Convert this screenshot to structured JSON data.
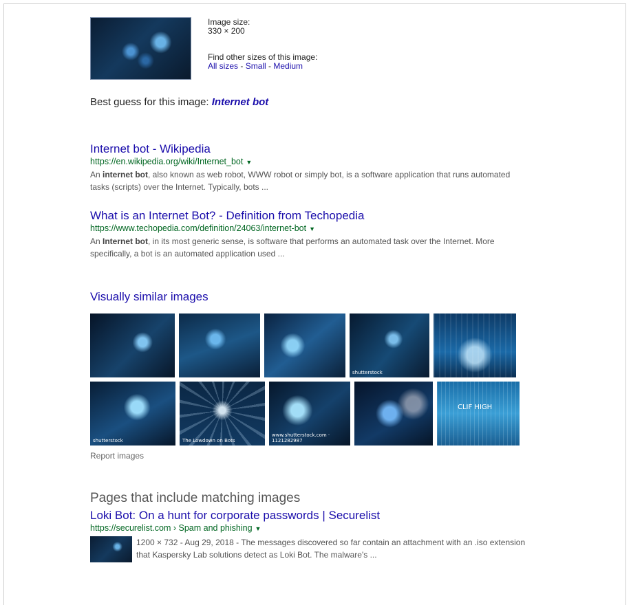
{
  "image_info": {
    "size_label": "Image size:",
    "size_value": "330 × 200",
    "find_label": "Find other sizes of this image:",
    "sizes": [
      "All sizes",
      "Small",
      "Medium"
    ],
    "sep": " - "
  },
  "best_guess": {
    "label": "Best guess for this image:",
    "value": "Internet bot"
  },
  "results": [
    {
      "title": "Internet bot - Wikipedia",
      "url": "https://en.wikipedia.org/wiki/Internet_bot",
      "snippet_pre": "An ",
      "snippet_bold": "internet bot",
      "snippet_post": ", also known as web robot, WWW robot or simply bot, is a software application that runs automated tasks (scripts) over the Internet. Typically, bots ..."
    },
    {
      "title": "What is an Internet Bot? - Definition from Techopedia",
      "url": "https://www.techopedia.com/definition/24063/internet-bot",
      "snippet_pre": "An ",
      "snippet_bold": "Internet bot",
      "snippet_post": ", in its most generic sense, is software that performs an automated task over the Internet. More specifically, a bot is an automated application used ..."
    }
  ],
  "similar": {
    "title": "Visually similar images",
    "row1": [
      {
        "caption": ""
      },
      {
        "caption": ""
      },
      {
        "caption": ""
      },
      {
        "caption": "shutterstock"
      },
      {
        "caption": ""
      }
    ],
    "row2": [
      {
        "caption": "shutterstock"
      },
      {
        "caption": "The Lowdown on Bots"
      },
      {
        "caption": "www.shutterstock.com · 1121282987"
      },
      {
        "caption": ""
      },
      {
        "caption": "CLIF HIGH"
      }
    ],
    "report": "Report images"
  },
  "pages": {
    "title": "Pages that include matching images",
    "result": {
      "title": "Loki Bot: On a hunt for corporate passwords | Securelist",
      "url": "https://securelist.com › Spam and phishing",
      "snippet": "1200 × 732 - Aug 29, 2018 - The messages discovered so far contain an attachment with an .iso extension that Kaspersky Lab solutions detect as Loki Bot. The malware's ..."
    }
  },
  "icons": {
    "caret": "▼"
  },
  "colors": {
    "link": "#1a0dab",
    "url": "#006621",
    "snippet": "#545454"
  }
}
